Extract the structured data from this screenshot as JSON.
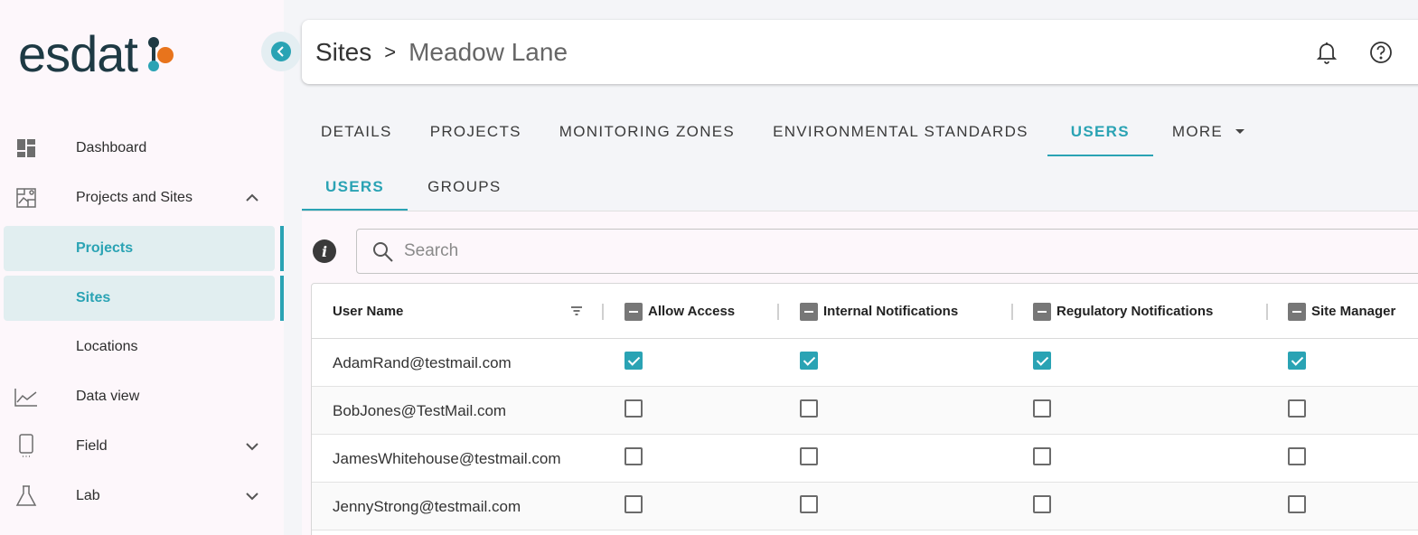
{
  "brand": {
    "name": "esdat",
    "colors": {
      "accent": "#2aa3b4",
      "dark": "#1e3a44",
      "orange": "#e8741c"
    }
  },
  "sidebar": {
    "items": [
      {
        "label": "Dashboard",
        "icon": "dashboard-icon"
      },
      {
        "label": "Projects and Sites",
        "icon": "map-icon",
        "expanded": true
      },
      {
        "label": "Projects",
        "active": true
      },
      {
        "label": "Sites",
        "active": true
      },
      {
        "label": "Locations"
      },
      {
        "label": "Data view",
        "icon": "chart-line-icon"
      },
      {
        "label": "Field",
        "icon": "mobile-device-icon",
        "expanded": false
      },
      {
        "label": "Lab",
        "icon": "flask-icon",
        "expanded": false
      }
    ]
  },
  "header": {
    "breadcrumb": [
      "Sites",
      "Meadow Lane"
    ],
    "separator": ">",
    "icons": [
      "bell-icon",
      "help-icon"
    ]
  },
  "tabs": [
    "DETAILS",
    "PROJECTS",
    "MONITORING ZONES",
    "ENVIRONMENTAL STANDARDS",
    "USERS",
    "MORE"
  ],
  "active_tab": "USERS",
  "subtabs": [
    "USERS",
    "GROUPS"
  ],
  "active_subtab": "USERS",
  "search": {
    "placeholder": "Search",
    "value": ""
  },
  "table": {
    "columns": [
      "User Name",
      "Allow Access",
      "Internal Notifications",
      "Regulatory Notifications",
      "Site Manager"
    ],
    "rows": [
      {
        "user": "AdamRand@testmail.com",
        "allow_access": true,
        "internal_notifications": true,
        "regulatory_notifications": true,
        "site_manager": true
      },
      {
        "user": "BobJones@TestMail.com",
        "allow_access": false,
        "internal_notifications": false,
        "regulatory_notifications": false,
        "site_manager": false
      },
      {
        "user": "JamesWhitehouse@testmail.com",
        "allow_access": false,
        "internal_notifications": false,
        "regulatory_notifications": false,
        "site_manager": false
      },
      {
        "user": "JennyStrong@testmail.com",
        "allow_access": false,
        "internal_notifications": false,
        "regulatory_notifications": false,
        "site_manager": false
      }
    ]
  }
}
